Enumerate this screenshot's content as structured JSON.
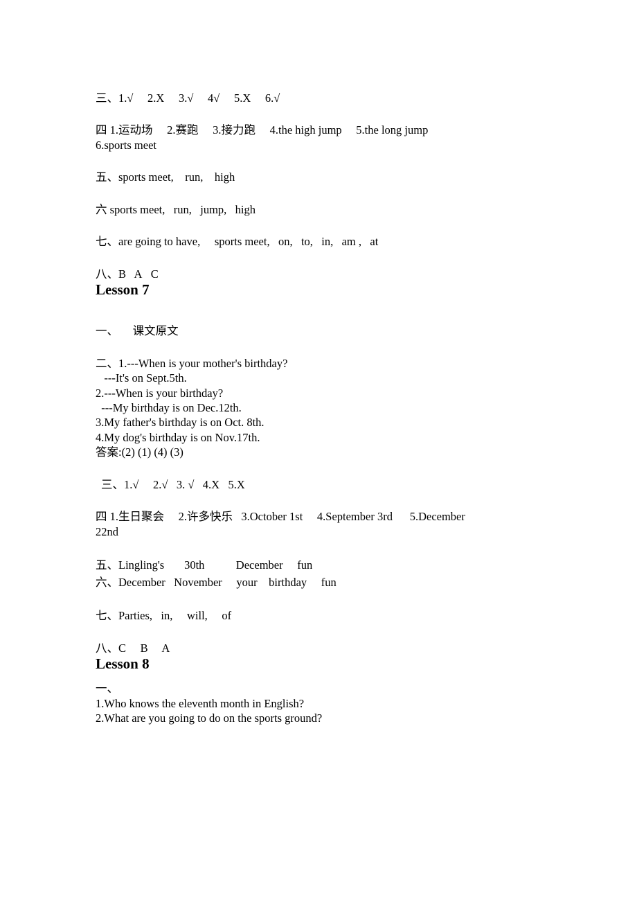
{
  "document": {
    "type": "answer-key",
    "background_color": "#ffffff",
    "text_color": "#000000"
  },
  "lesson6_tail": {
    "item_3": "三、1.√  2.X  3.√  4√  5.X  6.√",
    "item_4_line1": "四 1.运动场  2.赛跑  3.接力跑  4.the high jump  5.the long jump",
    "item_4_line2": "6.sports meet",
    "item_5": "五、sports meet,   run,   high",
    "item_6": "六 sports meet,  run,  jump,  high",
    "item_7": "七、are going to have,  sports meet,  on,  to,  in,  am ,  at",
    "item_8": "八、B  A  C"
  },
  "lesson7": {
    "heading": "Lesson 7",
    "item_1": "一、  课文原文",
    "item_2_lines": [
      "二、1.---When is your mother's birthday?",
      "   ---It's on Sept.5th.",
      "2.---When is your birthday?",
      "  ---My birthday is on Dec.12th.",
      "3.My father's birthday is on Oct. 8th.",
      "4.My dog's birthday is on Nov.17th.",
      "答案:(2) (1) (4) (3)"
    ],
    "item_3": "三、1.√  2.√  3. √  4.X  5.X",
    "item_4_line1": "四 1.生日聚会  2.许多快乐  3.October 1st  4.September 3rd   5.December",
    "item_4_line2": "22nd",
    "item_5": "五、Lingling's   30th    December  fun",
    "item_6": "六、December  November  your   birthday  fun",
    "item_7": "七、Parties,  in,  will,  of",
    "item_8": "八、C  B  A"
  },
  "lesson8": {
    "heading": "Lesson 8",
    "item_1_marker": "一、",
    "item_1_lines": [
      "1.Who knows the eleventh month in English?",
      "2.What are you going to do on the sports ground?"
    ]
  }
}
